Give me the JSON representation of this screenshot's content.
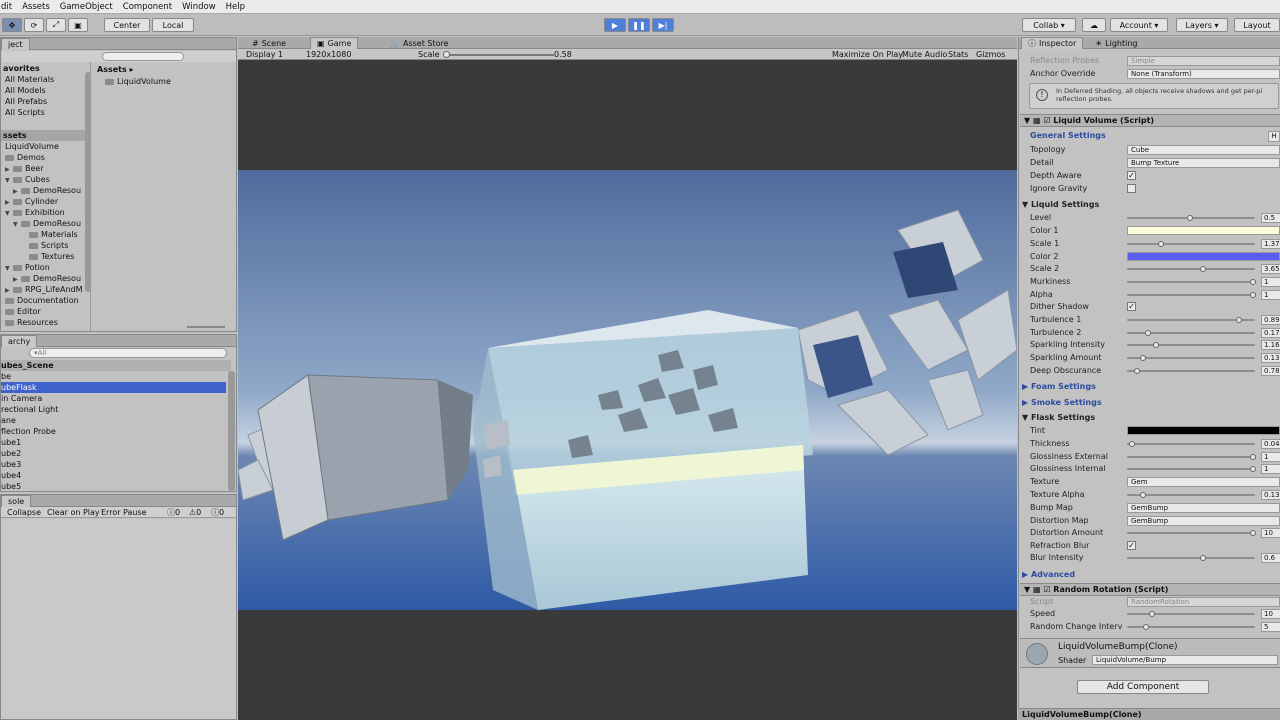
{
  "menu": [
    "dit",
    "Assets",
    "GameObject",
    "Component",
    "Window",
    "Help"
  ],
  "toolbar": {
    "pivot": "Center",
    "space": "Local",
    "collab": "Collab ▾",
    "account": "Account ▾",
    "layers": "Layers ▾",
    "layout": "Layout"
  },
  "project": {
    "tab": "ject",
    "favorites_header": "avorites",
    "favorites": [
      "All Materials",
      "All Models",
      "All Prefabs",
      "All Scripts"
    ],
    "assets_header": "ssets",
    "tree": [
      "LiquidVolume",
      "Demos",
      "Beer",
      "Cubes",
      "DemoResou",
      "Cylinder",
      "Exhibition",
      "DemoResou",
      "Materials",
      "Scripts",
      "Textures",
      "Potion",
      "DemoResou",
      "RPG_LifeAndM",
      "Documentation",
      "Editor",
      "Resources"
    ],
    "breadcrumb": "Assets ▸",
    "asset_item": "LiquidVolume"
  },
  "hierarchy": {
    "tab": "archy",
    "search_placeholder": "▾All",
    "scene": "ubes_Scene",
    "items": [
      "be",
      "ubeFlask",
      "in Camera",
      "rectional Light",
      "ane",
      "flection Probe",
      "ube1",
      "ube2",
      "ube3",
      "ube4",
      "ube5"
    ]
  },
  "console": {
    "tab": "sole",
    "buttons": [
      "Collapse",
      "Clear on Play",
      "Error Pause"
    ],
    "counts": [
      "0",
      "0",
      "0"
    ]
  },
  "game": {
    "tabs": [
      "Scene",
      "Game",
      "Asset Store"
    ],
    "display": "Display 1",
    "resolution": "1920x1080",
    "scale_label": "Scale",
    "scale_value": "0.58",
    "scale_fraction": 0.02,
    "options": [
      "Maximize On Play",
      "Mute Audio",
      "Stats",
      "Gizmos"
    ]
  },
  "inspector": {
    "tabs": [
      "Inspector",
      "Lighting"
    ],
    "reflection_probes_label": "Reflection Probes",
    "reflection_probes_value": "Simple",
    "anchor_label": "Anchor Override",
    "anchor_value": "None (Transform)",
    "info": "In Deferred Shading, all objects receive shadows and get per-pi reflection probes.",
    "component1": "Liquid Volume (Script)",
    "general": "General Settings",
    "topology_label": "Topology",
    "topology_value": "Cube",
    "detail_label": "Detail",
    "detail_value": "Bump Texture",
    "depth_aware": "Depth Aware",
    "ignore_gravity": "Ignore Gravity",
    "liquid": "Liquid Settings",
    "level": "Level",
    "level_val": "0.5",
    "level_f": 0.5,
    "color1": "Color 1",
    "color1_hex": "#fafcdc",
    "scale1": "Scale 1",
    "scale1_val": "1.37",
    "scale1_f": 0.27,
    "color2": "Color 2",
    "color2_hex": "#5b5cf0",
    "scale2": "Scale 2",
    "scale2_val": "3.65",
    "scale2_f": 0.6,
    "murkiness": "Murkiness",
    "murkiness_val": "1",
    "alpha": "Alpha",
    "alpha_val": "1",
    "dither": "Dither Shadow",
    "turb1": "Turbulence 1",
    "turb1_val": "0.89",
    "turb1_f": 0.89,
    "turb2": "Turbulence 2",
    "turb2_val": "0.17",
    "turb2_f": 0.17,
    "spark_int": "Sparkling Intensity",
    "spark_int_val": "1.16",
    "spark_int_f": 0.23,
    "spark_amt": "Sparkling Amount",
    "spark_amt_val": "0.13",
    "spark_amt_f": 0.13,
    "deep": "Deep Obscurance",
    "deep_val": "0.78",
    "deep_f": 0.08,
    "foam": "Foam Settings",
    "smoke": "Smoke Settings",
    "flask": "Flask Settings",
    "tint": "Tint",
    "tint_hex": "#000000",
    "thickness": "Thickness",
    "thickness_val": "0.04",
    "thickness_f": 0.04,
    "gloss_ext": "Glossiness External",
    "gloss_ext_val": "1",
    "gloss_int": "Glossiness Internal",
    "gloss_int_val": "1",
    "texture": "Texture",
    "texture_val": "Gem",
    "tex_alpha": "Texture Alpha",
    "tex_alpha_val": "0.13",
    "tex_alpha_f": 0.13,
    "bump": "Bump Map",
    "bump_val": "GemBump",
    "distortion_map": "Distortion Map",
    "distortion_map_val": "GemBump",
    "distortion_amt": "Distortion Amount",
    "distortion_amt_val": "10",
    "refraction_blur": "Refraction Blur",
    "blur": "Blur Intensity",
    "blur_val": "0.6",
    "blur_f": 0.6,
    "advanced": "Advanced",
    "component2": "Random Rotation (Script)",
    "script_label": "Script",
    "script_val": "RandomRotation",
    "speed": "Speed",
    "speed_val": "10",
    "speed_f": 0.2,
    "random_change": "Random Change Interv",
    "random_change_val": "5",
    "random_change_f": 0.15,
    "material": "LiquidVolumeBump(Clone)",
    "shader_label": "Shader",
    "shader_val": "LiquidVolume/Bump",
    "add_component": "Add Component",
    "footer": "LiquidVolumeBump(Clone)"
  }
}
